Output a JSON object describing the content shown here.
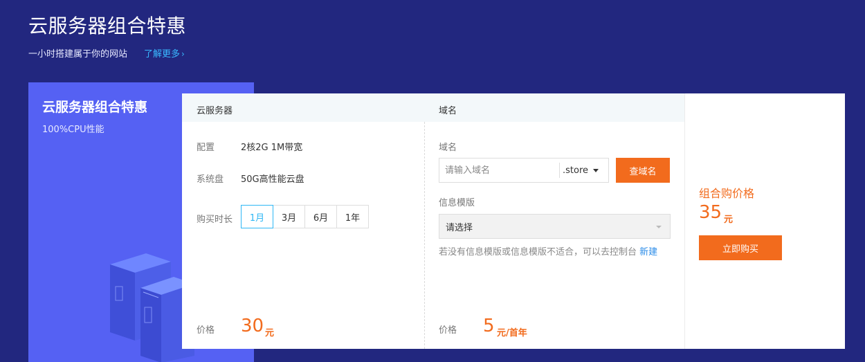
{
  "header": {
    "title": "云服务器组合特惠",
    "subtitle": "一小时搭建属于你的网站",
    "learn_more": "了解更多",
    "learn_more_icon": "chevron-right-icon"
  },
  "promo": {
    "title": "云服务器组合特惠",
    "subtitle": "100%CPU性能",
    "illustration": "server-illustration"
  },
  "server": {
    "header": "云服务器",
    "config_label": "配置",
    "config_value": "2核2G  1M带宽",
    "disk_label": "系统盘",
    "disk_value": "50G高性能云盘",
    "duration_label": "购买时长",
    "durations": [
      "1月",
      "3月",
      "6月",
      "1年"
    ],
    "selected_duration": "1月",
    "price_label": "价格",
    "price": "30",
    "price_unit": "元"
  },
  "domain": {
    "header": "域名",
    "field_label": "域名",
    "input_value": "",
    "input_placeholder": "请输入域名",
    "tld": ".store",
    "query_button": "查域名",
    "template_label": "信息模版",
    "template_value": "请选择",
    "hint_text": "若没有信息模版或信息模版不适合，可以去控制台 ",
    "hint_link": "新建",
    "price_label": "价格",
    "price": "5",
    "price_unit": "元/首年"
  },
  "combo": {
    "label": "组合购价格",
    "price": "35",
    "price_unit": "元",
    "buy_button": "立即购买"
  },
  "colors": {
    "background": "#22277f",
    "promo_card": "#5561f3",
    "accent_orange": "#f26b1d",
    "link_blue": "#39b9ff",
    "active_blue": "#2db7f5"
  }
}
